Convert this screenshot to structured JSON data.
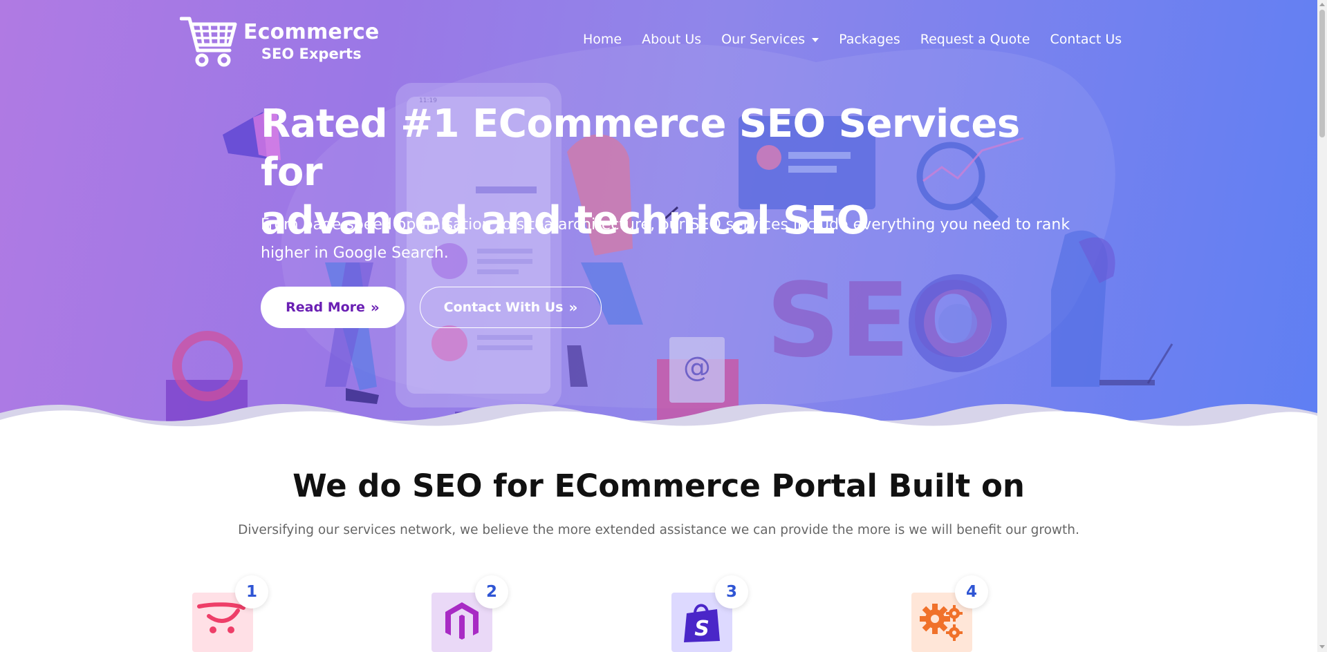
{
  "logo": {
    "line1": "Ecommerce",
    "line2": "SEO Experts",
    "icon": "shopping-cart-icon"
  },
  "nav": {
    "items": [
      {
        "label": "Home"
      },
      {
        "label": "About Us"
      },
      {
        "label": "Our Services",
        "has_dropdown": true
      },
      {
        "label": "Packages"
      },
      {
        "label": "Request a Quote"
      },
      {
        "label": "Contact Us"
      }
    ]
  },
  "hero": {
    "title_line1": "Rated #1 ECommerce SEO Services for",
    "title_line2": "advanced and technical SEO",
    "subtitle": "From page speed optimisation to sitea architecture, our SEO services include everything you need to rank higher in Google Search.",
    "read_more_label": "Read More",
    "contact_label": "Contact With Us",
    "illustration_text": "SEO",
    "illustration_email_symbol": "@"
  },
  "platforms": {
    "title": "We do SEO for ECommerce Portal Built on",
    "subtitle": "Diversifying our services network, we believe the more extended assistance we can provide the more is we will benefit our growth.",
    "cards": [
      {
        "number": "1",
        "icon": "opencart-icon"
      },
      {
        "number": "2",
        "icon": "magento-icon"
      },
      {
        "number": "3",
        "icon": "shopify-icon"
      },
      {
        "number": "4",
        "icon": "custom-gears-icon"
      }
    ]
  },
  "colors": {
    "hero_gradient_start": "#b07ae3",
    "hero_gradient_end": "#5f7ff3",
    "primary_button_text": "#6a1fb3",
    "badge_number": "#2f55d4"
  }
}
